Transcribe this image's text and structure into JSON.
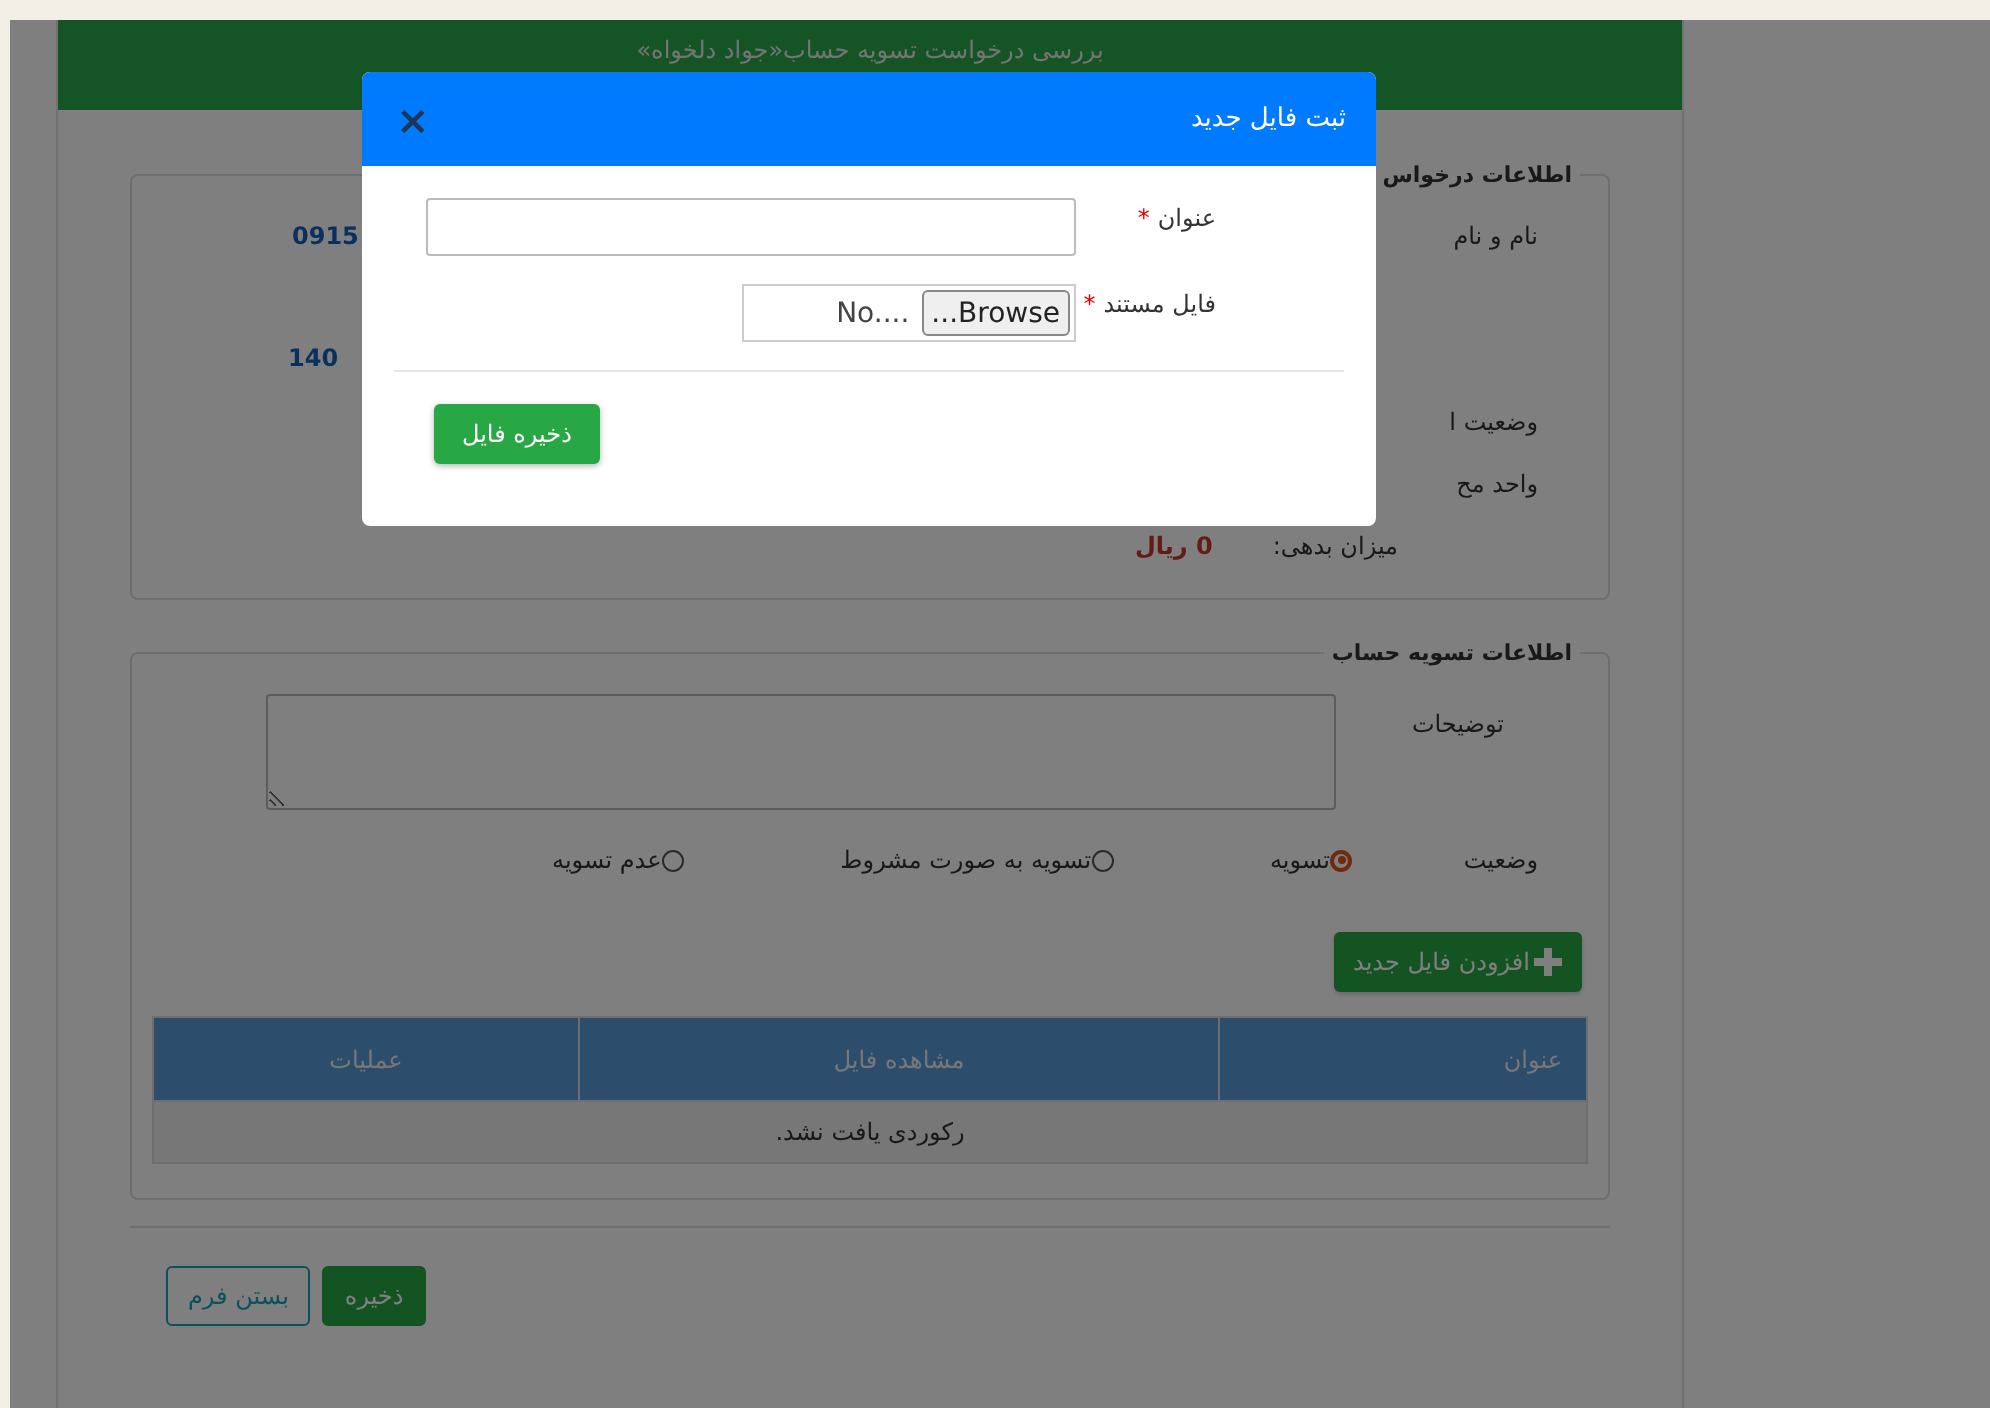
{
  "page": {
    "title": "بررسی درخواست تسویه حساب«جواد دلخواه»"
  },
  "request_info": {
    "legend": "اطلاعات درخواس",
    "rows": [
      {
        "kind": "contact",
        "label": "نام و نام",
        "value": "0915"
      },
      {
        "kind": "value_only",
        "value": "140"
      },
      {
        "kind": "label_only",
        "label": "وضعیت ا"
      },
      {
        "kind": "label_only",
        "label": "واحد مح"
      },
      {
        "kind": "debt",
        "label": "میزان بدهی:",
        "value": "0 ریال"
      }
    ]
  },
  "settlement": {
    "legend": "اطلاعات تسویه حساب",
    "description_label": "توضیحات",
    "status_label": "وضعیت",
    "options": [
      {
        "label": "تسویه",
        "selected": true
      },
      {
        "label": "تسویه به صورت مشروط",
        "selected": false
      },
      {
        "label": "عدم تسویه",
        "selected": false
      }
    ],
    "add_button": "افزودن فایل جدید",
    "table": {
      "columns": [
        "عنوان",
        "مشاهده فایل",
        "عملیات"
      ],
      "empty_message": "رکوردی یافت نشد."
    }
  },
  "buttons": [
    {
      "kind": "primary",
      "label": "ذخیره"
    },
    {
      "kind": "outline",
      "label": "بستن فرم"
    }
  ],
  "modal": {
    "title": "ثبت فایل جدید",
    "close": "×",
    "fields": [
      {
        "kind": "text",
        "label": "عنوان",
        "required": true,
        "required_mark": "*"
      },
      {
        "kind": "file",
        "label": "فایل مستند",
        "required": true,
        "required_mark": "*",
        "button": "...Browse",
        "file_name": "No...."
      }
    ],
    "save_button": "ذخیره فایل"
  }
}
